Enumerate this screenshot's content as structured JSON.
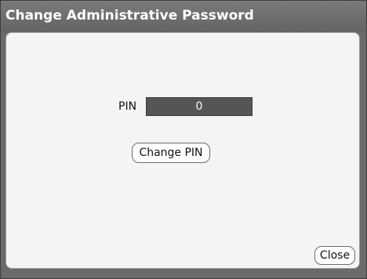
{
  "dialog": {
    "title": "Change Administrative Password"
  },
  "pin": {
    "label": "PIN",
    "value": "0"
  },
  "buttons": {
    "change_pin_label": "Change PIN",
    "close_label": "Close"
  }
}
